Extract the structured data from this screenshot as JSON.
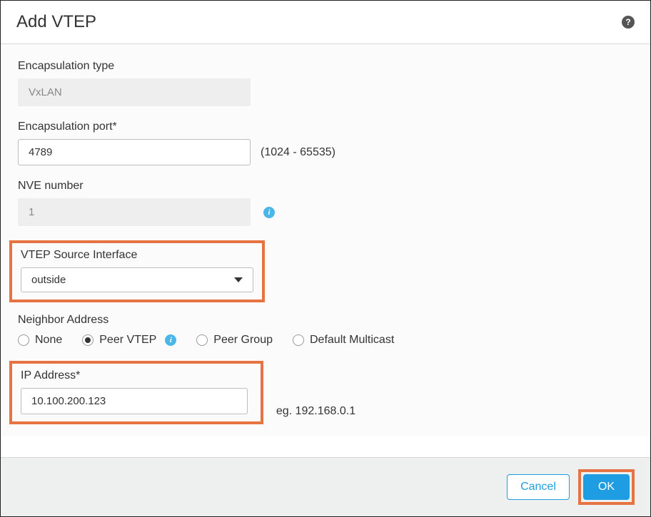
{
  "title": "Add VTEP",
  "fields": {
    "encapsulation_type": {
      "label": "Encapsulation type",
      "value": "VxLAN"
    },
    "encapsulation_port": {
      "label": "Encapsulation port*",
      "value": "4789",
      "hint": "(1024 - 65535)"
    },
    "nve_number": {
      "label": "NVE number",
      "value": "1"
    },
    "vtep_source": {
      "label": "VTEP Source Interface",
      "selected": "outside"
    },
    "neighbor_address": {
      "label": "Neighbor Address",
      "options": {
        "none": "None",
        "peer_vtep": "Peer VTEP",
        "peer_group": "Peer Group",
        "default_multicast": "Default Multicast"
      },
      "selected": "peer_vtep"
    },
    "ip_address": {
      "label": "IP Address*",
      "value": "10.100.200.123",
      "hint": "eg. 192.168.0.1"
    }
  },
  "buttons": {
    "cancel": "Cancel",
    "ok": "OK"
  },
  "help_glyph": "?",
  "info_glyph": "i"
}
